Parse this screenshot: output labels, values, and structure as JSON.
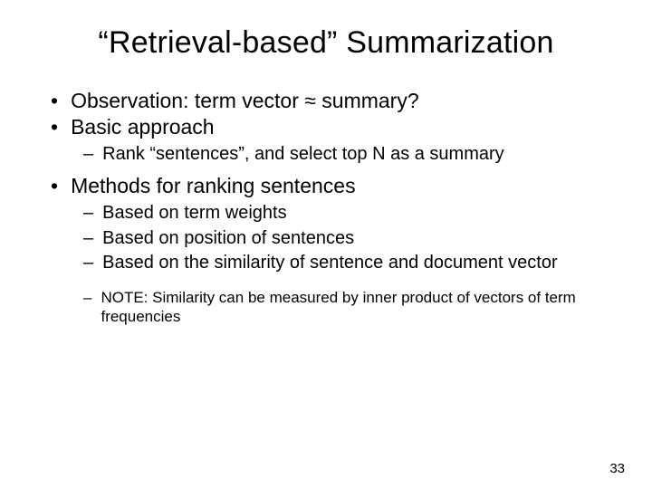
{
  "title": "“Retrieval-based” Summarization",
  "bullets": {
    "b1": "Observation: term vector ≈ summary?",
    "b2": "Basic approach",
    "b2_sub1": "Rank “sentences”, and select top N as a summary",
    "b3": "Methods for ranking sentences",
    "b3_sub1": "Based on term weights",
    "b3_sub2": "Based on position of sentences",
    "b3_sub3": "Based on the similarity of sentence and document vector",
    "b3_note": "NOTE: Similarity can be measured by inner product of vectors of term frequencies"
  },
  "page_number": "33"
}
